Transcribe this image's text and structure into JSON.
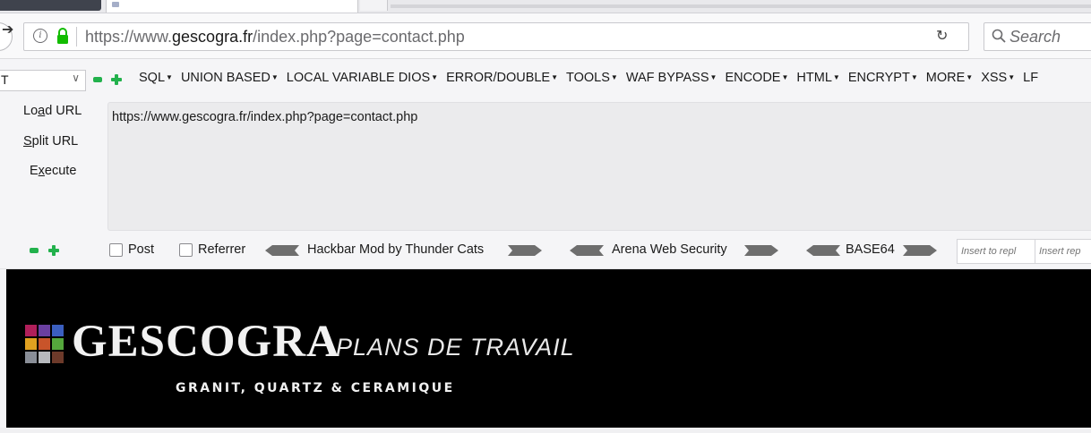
{
  "browser": {
    "url_prefix": "https://www.",
    "url_host": "gescogra.fr",
    "url_path": "/index.php?page=contact.php",
    "search_placeholder": "Search"
  },
  "hackbar": {
    "version_select_value": "T",
    "menus": [
      "SQL",
      "UNION BASED",
      "LOCAL VARIABLE DIOS",
      "ERROR/DOUBLE",
      "TOOLS",
      "WAF BYPASS",
      "ENCODE",
      "HTML",
      "ENCRYPT",
      "MORE",
      "XSS",
      "LF"
    ],
    "load_url_pre": "Lo",
    "load_url_key": "a",
    "load_url_post": "d URL",
    "split_url_key": "S",
    "split_url_post": "plit URL",
    "execute_pre": "E",
    "execute_key": "x",
    "execute_post": "ecute",
    "url_value": "https://www.gescogra.fr/index.php?page=contact.php",
    "post_label": "Post",
    "referrer_label": "Referrer",
    "banner1": "Hackbar Mod by Thunder Cats",
    "banner2": "Arena Web Security",
    "banner3": "BASE64",
    "insert_placeholder1": "Insert to repl",
    "insert_placeholder2": "Insert rep"
  },
  "site": {
    "logo_word": "GESCOGRA",
    "logo_tag": "PLANS DE TRAVAIL",
    "logo_sub": "GRANIT, QUARTZ & CERAMIQUE"
  },
  "colors": {
    "hackbar_green": "#22b14c",
    "site_background": "#000000"
  }
}
